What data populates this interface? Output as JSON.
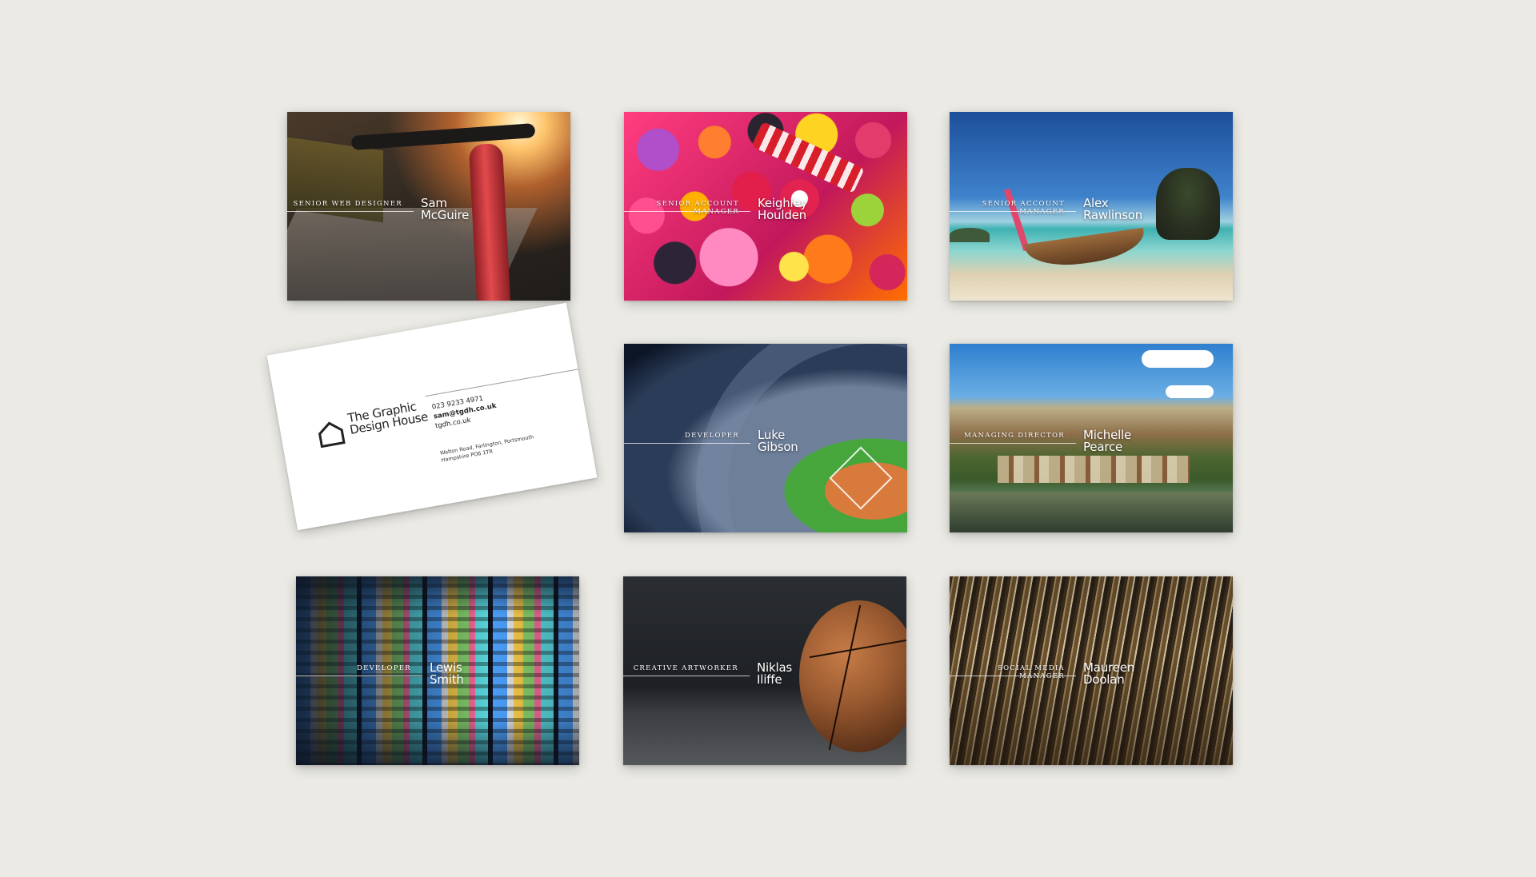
{
  "cards": [
    {
      "role": "Senior Web Designer",
      "name_line1": "Sam",
      "name_line2": "McGuire",
      "background": "cycle-handlebars"
    },
    {
      "role": "Senior Account Manager",
      "name_line1": "Keighley",
      "name_line2": "Houlden",
      "background": "sweets"
    },
    {
      "role": "Senior Account Manager",
      "name_line1": "Alex",
      "name_line2": "Rawlinson",
      "background": "beach-longtail-boat"
    },
    {
      "role": "Developer",
      "name_line1": "Luke",
      "name_line2": "Gibson",
      "background": "baseball-stadium"
    },
    {
      "role": "Managing Director",
      "name_line1": "Michelle",
      "name_line2": "Pearce",
      "background": "cliff-village-river"
    },
    {
      "role": "Developer",
      "name_line1": "Lewis",
      "name_line2": "Smith",
      "background": "code-screen"
    },
    {
      "role": "Creative Artworker",
      "name_line1": "Niklas",
      "name_line2": "Iliffe",
      "background": "basketball"
    },
    {
      "role": "Social Media Manager",
      "name_line1": "Maureen",
      "name_line2": "Doolan",
      "background": "vinyl-records"
    }
  ],
  "back_card": {
    "company_line1": "The Graphic",
    "company_line2": "Design House",
    "phone": "023 9233 4971",
    "email": "sam@tgdh.co.uk",
    "website": "tgdh.co.uk",
    "address_line1": "Walton Road, Farlington, Portsmouth",
    "address_line2": "Hampshire PO6 1TR",
    "logo_icon": "house-outline-icon"
  },
  "colors": {
    "page_background": "#ebeae5",
    "text_on_card": "#ffffff"
  }
}
